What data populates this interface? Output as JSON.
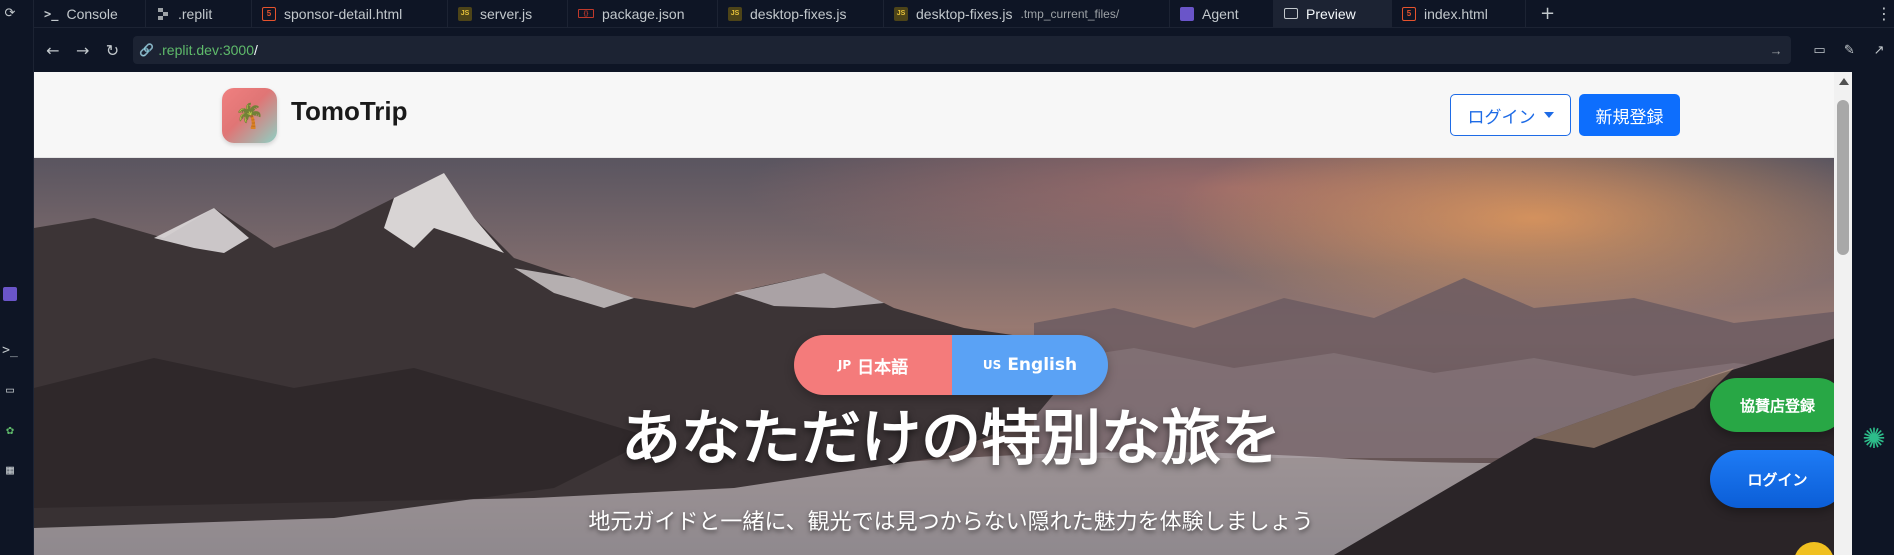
{
  "rail": {
    "icons": [
      "workspace-icon",
      "agent-icon",
      "console-icon",
      "preview-icon",
      "deploy-icon",
      "apps-grid-icon"
    ]
  },
  "tabs": [
    {
      "label": "Console",
      "icon": "console-icon",
      "sub": ""
    },
    {
      "label": ".replit",
      "icon": "replit-icon",
      "sub": ""
    },
    {
      "label": "sponsor-detail.html",
      "icon": "html-file-icon",
      "sub": ""
    },
    {
      "label": "server.js",
      "icon": "js-file-icon",
      "sub": ""
    },
    {
      "label": "package.json",
      "icon": "json-file-icon",
      "sub": ""
    },
    {
      "label": "desktop-fixes.js",
      "icon": "js-file-icon",
      "sub": ""
    },
    {
      "label": "desktop-fixes.js",
      "icon": "js-file-icon",
      "sub": ".tmp_current_files/"
    },
    {
      "label": "Agent",
      "icon": "agent-icon",
      "sub": ""
    },
    {
      "label": "Preview",
      "icon": "preview-icon",
      "sub": "",
      "active": true
    },
    {
      "label": "index.html",
      "icon": "html-file-icon",
      "sub": ""
    }
  ],
  "address": {
    "host": ".replit.dev:3000",
    "path": "/"
  },
  "site": {
    "brand": "TomoTrip",
    "logo_glyph": "🌴",
    "login_label": "ログイン",
    "signup_label": "新規登録",
    "lang_jp_code": "JP",
    "lang_jp_label": "日本語",
    "lang_en_code": "US",
    "lang_en_label": "English",
    "hero_title": "あなただけの特別な旅を",
    "hero_subtitle": "地元ガイドと一緒に、観光では見つからない隠れた魅力を体験しましょう",
    "float_sponsor_label": "協賛店登録",
    "float_login_label": "ログイン"
  },
  "colors": {
    "accent_blue": "#0d6efd",
    "sponsor_green": "#28a745",
    "lang_jp": "#f47b7b",
    "lang_en": "#5aa2f5",
    "ide_bg": "#0e1525"
  }
}
